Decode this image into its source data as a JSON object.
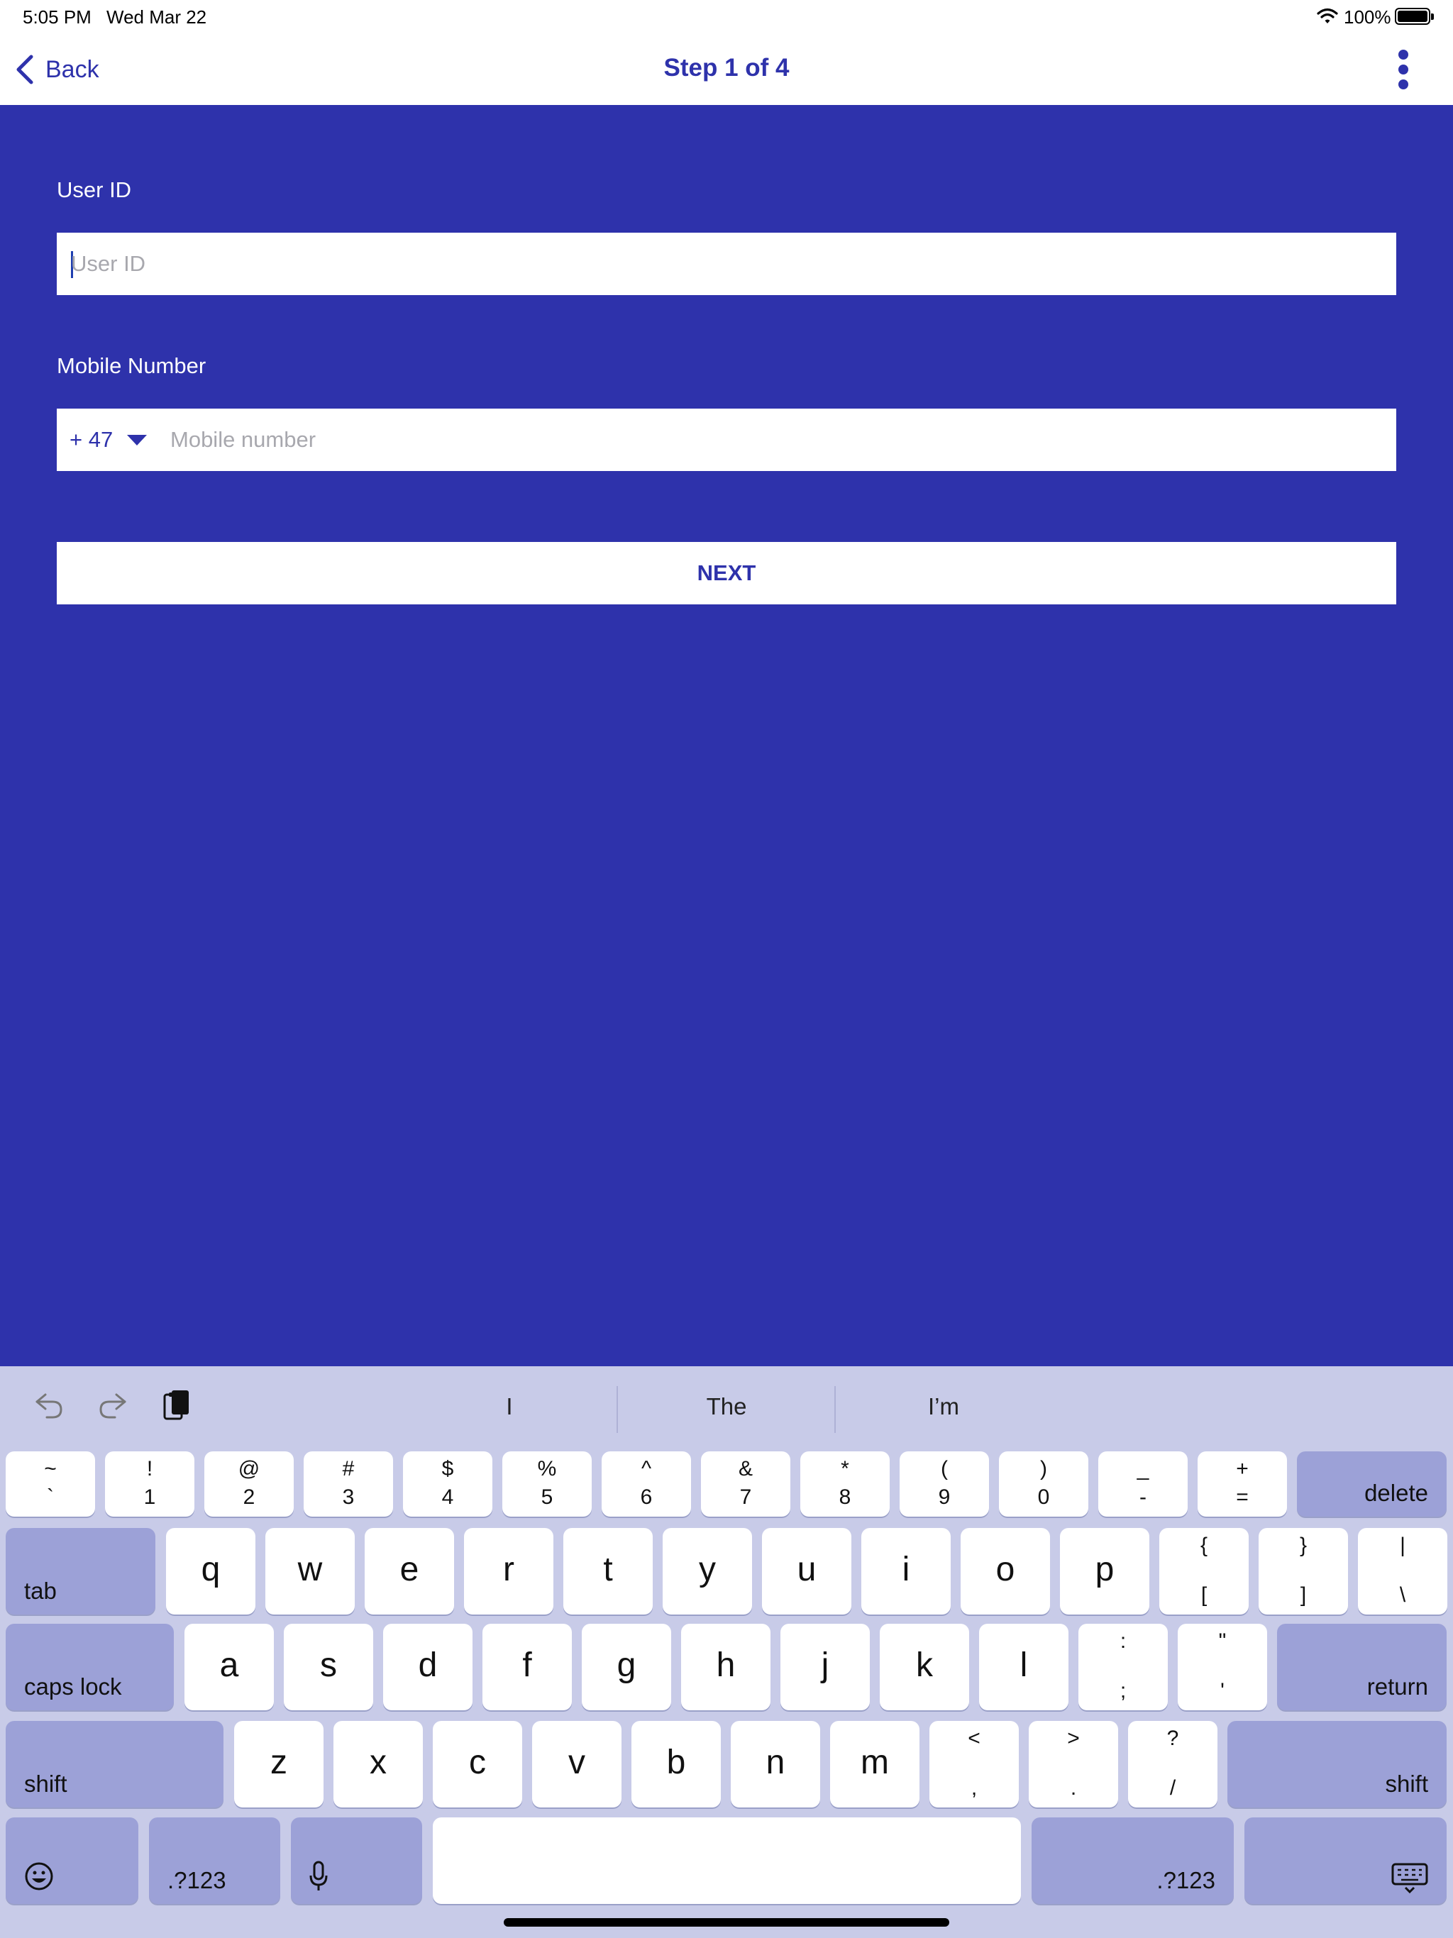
{
  "status_bar": {
    "time": "5:05 PM",
    "date": "Wed Mar 22",
    "battery_pct": "100%"
  },
  "nav": {
    "back_label": "Back",
    "title": "Step 1 of 4"
  },
  "form": {
    "user_id_label": "User ID",
    "user_id_placeholder": "User ID",
    "mobile_label": "Mobile Number",
    "country_code": "+ 47",
    "mobile_placeholder": "Mobile number",
    "next_label": "NEXT"
  },
  "keyboard": {
    "suggestions": [
      "I",
      "The",
      "I’m"
    ],
    "number_row": [
      {
        "top": "~",
        "bottom": "`"
      },
      {
        "top": "!",
        "bottom": "1"
      },
      {
        "top": "@",
        "bottom": "2"
      },
      {
        "top": "#",
        "bottom": "3"
      },
      {
        "top": "$",
        "bottom": "4"
      },
      {
        "top": "%",
        "bottom": "5"
      },
      {
        "top": "^",
        "bottom": "6"
      },
      {
        "top": "&",
        "bottom": "7"
      },
      {
        "top": "*",
        "bottom": "8"
      },
      {
        "top": "(",
        "bottom": "9"
      },
      {
        "top": ")",
        "bottom": "0"
      },
      {
        "top": "_",
        "bottom": "-"
      },
      {
        "top": "+",
        "bottom": "="
      }
    ],
    "delete_label": "delete",
    "tab_label": "tab",
    "row_q": [
      "q",
      "w",
      "e",
      "r",
      "t",
      "y",
      "u",
      "i",
      "o",
      "p"
    ],
    "row_q_symbols": [
      {
        "top": "{",
        "bottom": "["
      },
      {
        "top": "}",
        "bottom": "]"
      },
      {
        "top": "|",
        "bottom": "\\"
      }
    ],
    "caps_label": "caps lock",
    "row_a": [
      "a",
      "s",
      "d",
      "f",
      "g",
      "h",
      "j",
      "k",
      "l"
    ],
    "row_a_symbols": [
      {
        "top": ":",
        "bottom": ";"
      },
      {
        "top": "\"",
        "bottom": "'"
      }
    ],
    "return_label": "return",
    "shift_label": "shift",
    "row_z": [
      "z",
      "x",
      "c",
      "v",
      "b",
      "n",
      "m"
    ],
    "row_z_symbols": [
      {
        "top": "<",
        "bottom": ","
      },
      {
        "top": ">",
        "bottom": "."
      },
      {
        "top": "?",
        "bottom": "/"
      }
    ],
    "numbers_label": ".?123"
  },
  "colors": {
    "brand": "#2E32AB",
    "keyboard_bg": "#C8CBE8",
    "modifier_key": "#9CA1D7"
  }
}
